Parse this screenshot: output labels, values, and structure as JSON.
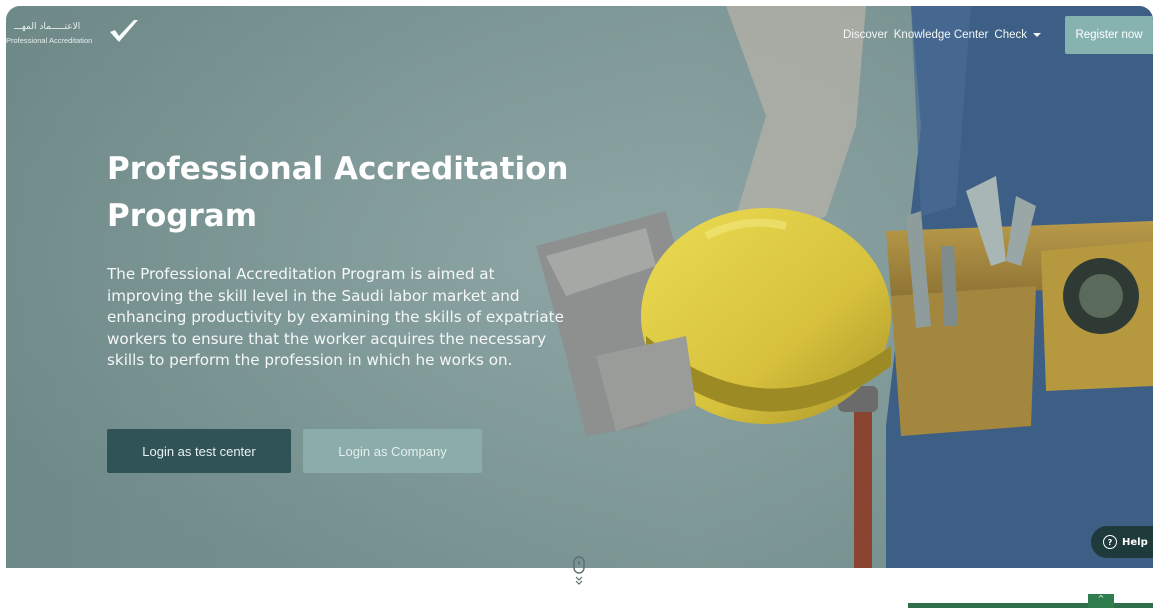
{
  "logo": {
    "arabic_text": "الاعتـــــماد المهـــ",
    "english_text": "Professional Accreditation"
  },
  "nav": {
    "links": [
      "Discover",
      "Knowledge Center"
    ],
    "check_label": "Check",
    "register_label": "Register now"
  },
  "hero": {
    "title_line1": "Professional Accreditation",
    "title_line2": "Program",
    "description": "The Professional Accreditation Program is aimed at improving the skill level in the Saudi labor market and enhancing productivity by examining the skills of expatriate workers to ensure that the worker acquires the necessary skills to perform the profession in which he works on.",
    "login_test_center": "Login as test center",
    "login_company": "Login as Company"
  },
  "help": {
    "label": "Help"
  },
  "colors": {
    "hero_tint": "#7f9999",
    "primary_dark": "#2f5356",
    "accent": "#86b3af",
    "green": "#2f7d4d"
  },
  "icons": [
    "check-logo-icon",
    "caret-down-icon",
    "help-circle-icon",
    "scroll-mouse-icon",
    "chevron-up-icon"
  ]
}
